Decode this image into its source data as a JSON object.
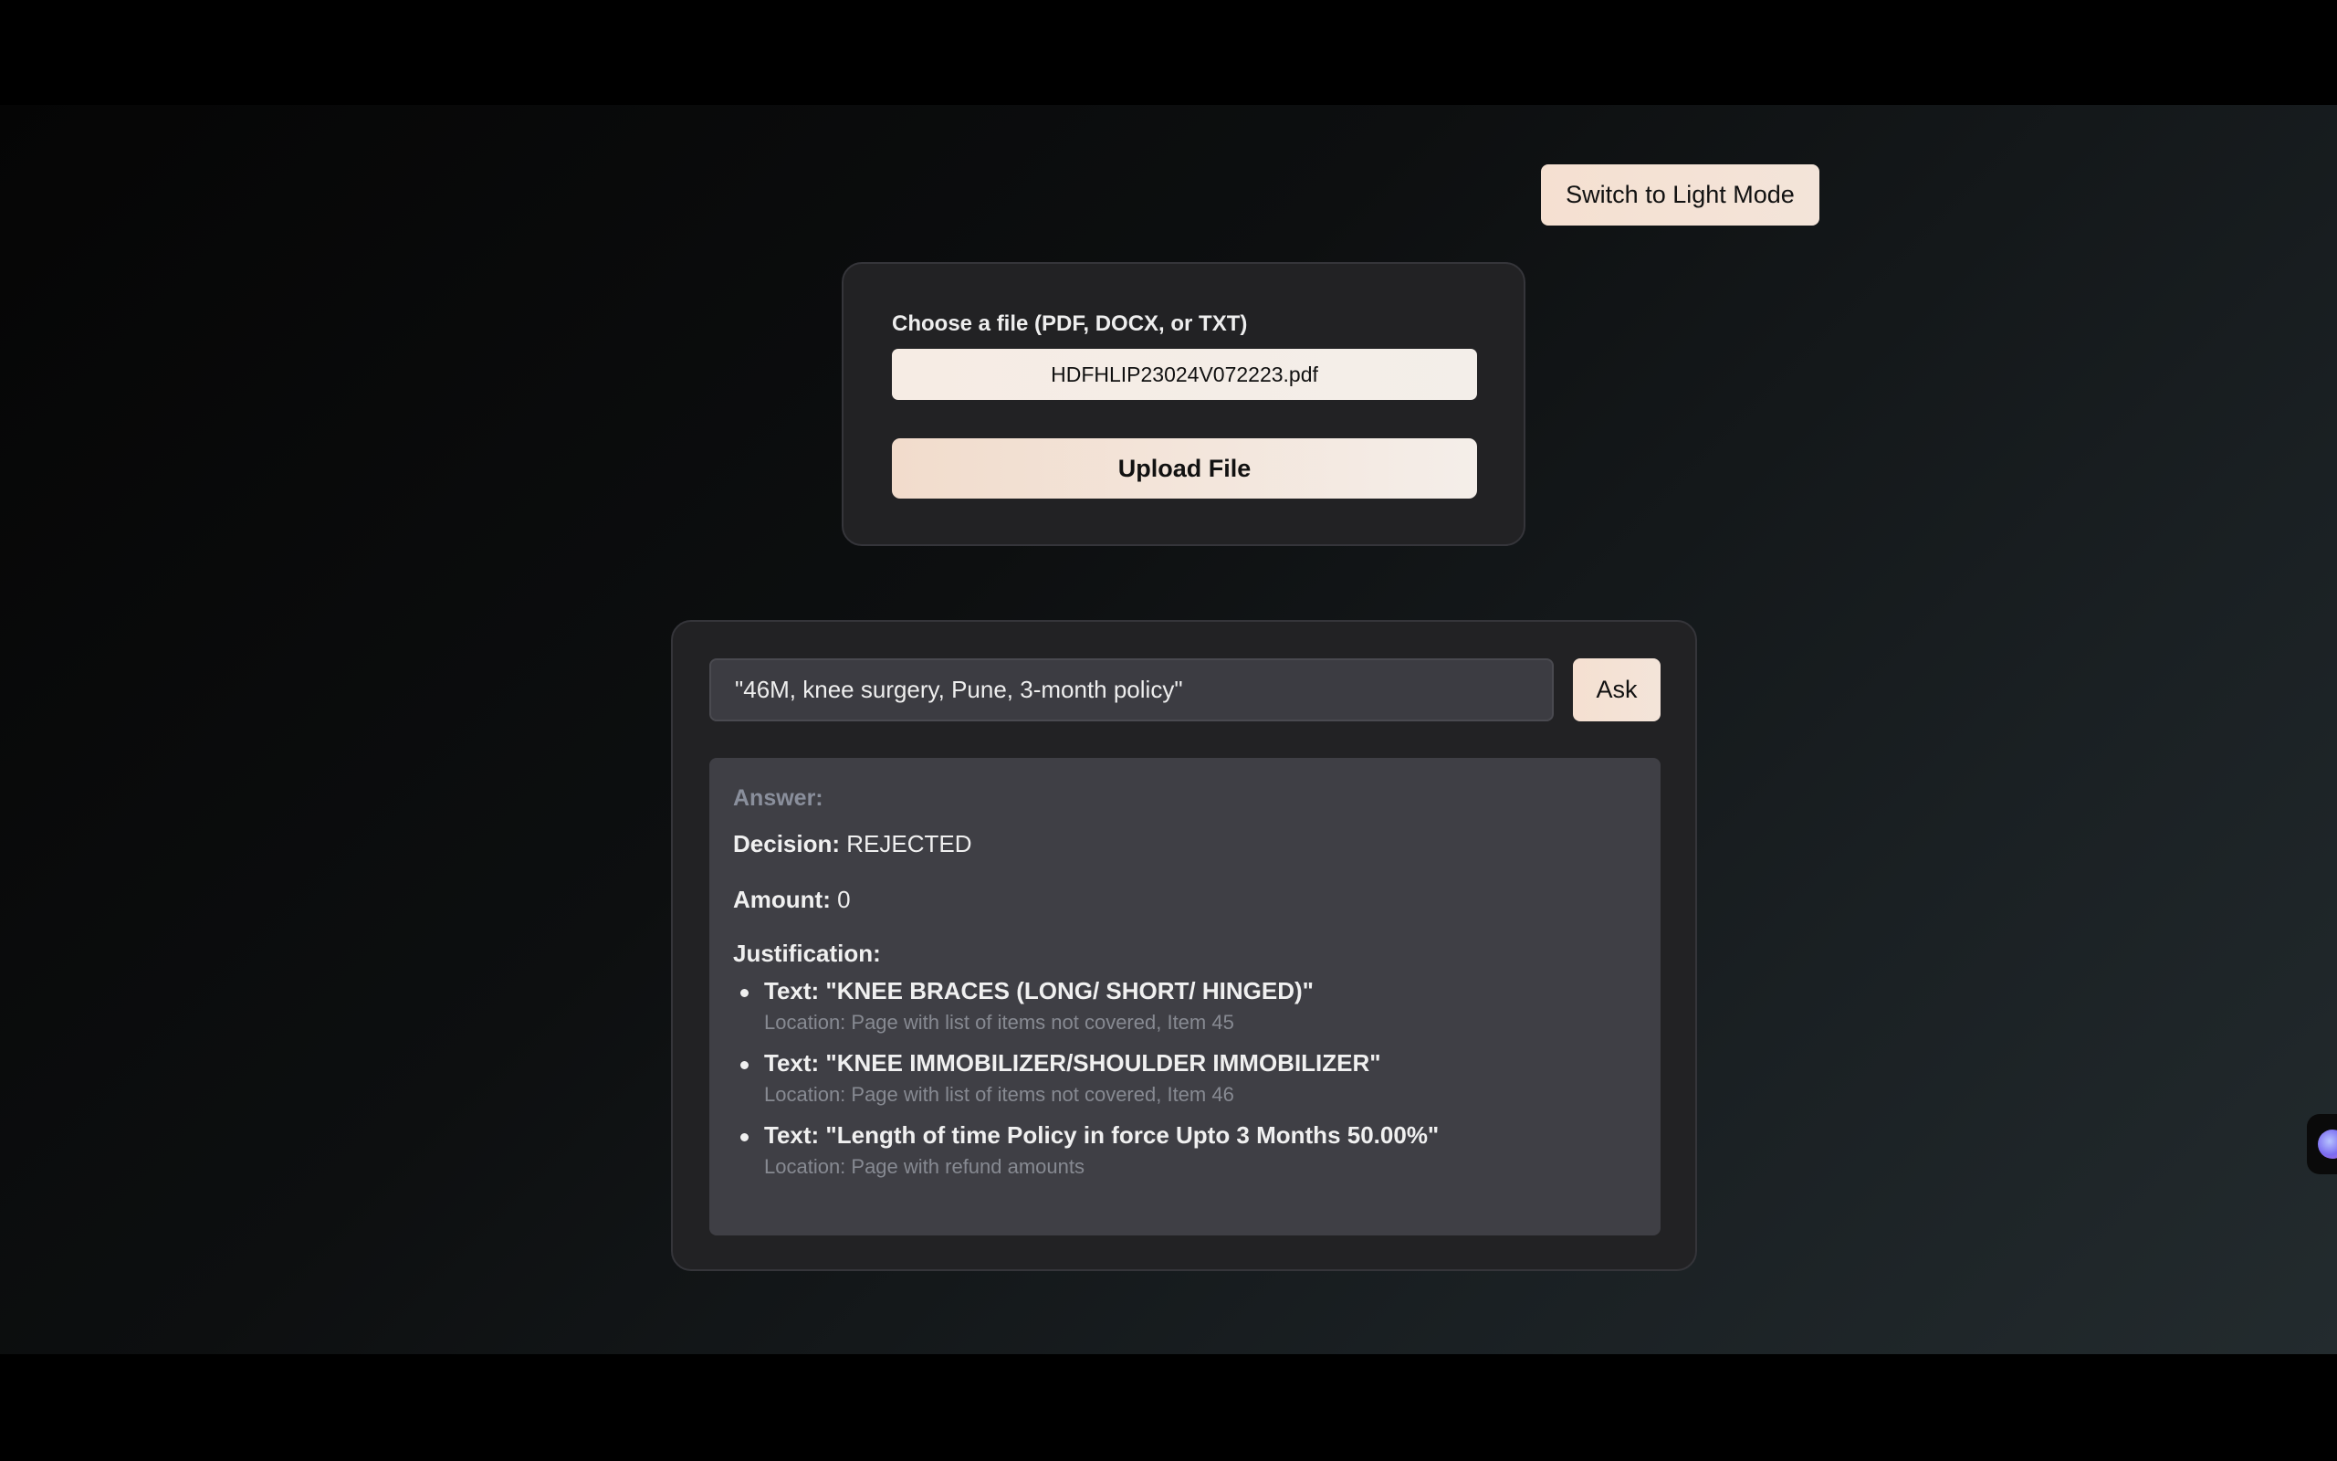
{
  "theme_toggle": {
    "label": "Switch to Light Mode"
  },
  "upload": {
    "label": "Choose a file (PDF, DOCX, or TXT)",
    "file_name": "HDFHLIP23024V072223.pdf",
    "button_label": "Upload File"
  },
  "query": {
    "input_value": "\"46M, knee surgery, Pune, 3-month policy\"",
    "ask_label": "Ask"
  },
  "answer": {
    "heading": "Answer:",
    "decision_label": "Decision:",
    "decision_value": "REJECTED",
    "amount_label": "Amount:",
    "amount_value": "0",
    "justification_label": "Justification:",
    "justifications": [
      {
        "text": "Text: \"KNEE BRACES (LONG/ SHORT/ HINGED)\"",
        "location": "Location: Page with list of items not covered, Item 45"
      },
      {
        "text": "Text: \"KNEE IMMOBILIZER/SHOULDER IMMOBILIZER\"",
        "location": "Location: Page with list of items not covered, Item 46"
      },
      {
        "text": "Text: \"Length of time Policy in force Upto 3 Months 50.00%\"",
        "location": "Location: Page with refund amounts"
      }
    ]
  },
  "floating_widget": {
    "icon": "assistant-orb-icon"
  }
}
